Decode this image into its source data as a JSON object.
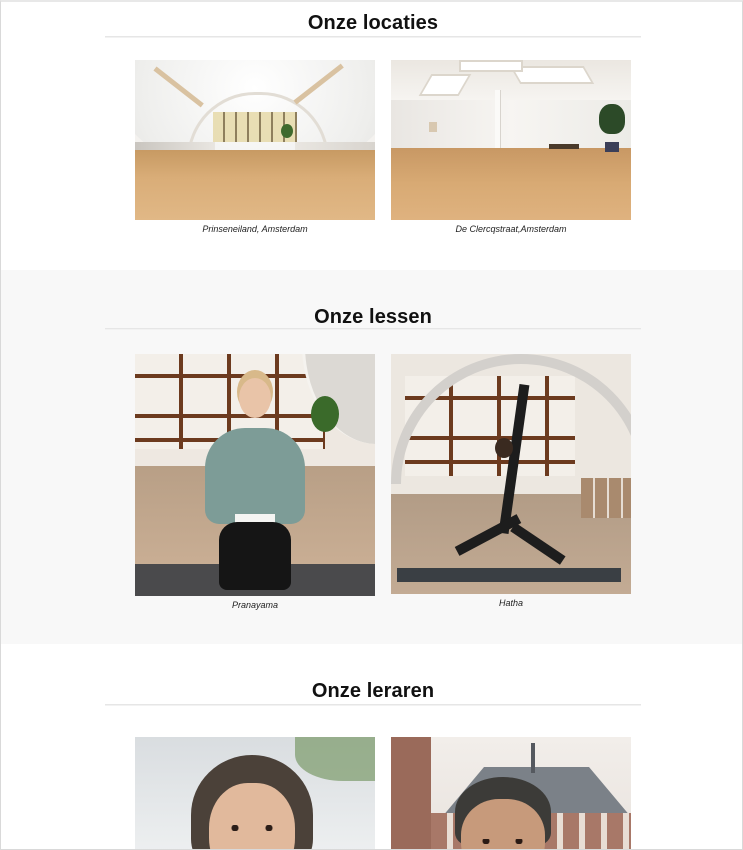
{
  "sections": {
    "locations": {
      "title": "Onze locaties",
      "items": [
        {
          "caption": "Prinseneiland, Amsterdam",
          "image": "arched-hall-photo"
        },
        {
          "caption": "De Clercqstraat,Amsterdam",
          "image": "skylight-studio-photo"
        }
      ]
    },
    "lessons": {
      "title": "Onze lessen",
      "items": [
        {
          "caption": "Pranayama",
          "image": "seated-breathing-photo"
        },
        {
          "caption": "Hatha",
          "image": "warrior-pose-photo"
        }
      ]
    },
    "teachers": {
      "title": "Onze leraren",
      "items": [
        {
          "image": "teacher-portrait-1"
        },
        {
          "image": "teacher-portrait-2"
        }
      ]
    }
  },
  "colors": {
    "alt_section_background": "#f8f8f8",
    "heading_text": "#111111",
    "rule": "#e6e6e6"
  }
}
